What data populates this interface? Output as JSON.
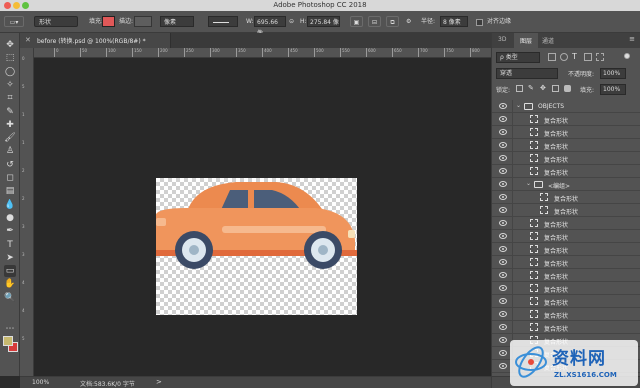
{
  "window": {
    "title": "Adobe Photoshop CC 2018"
  },
  "colors": {
    "accent_fill": "#e05858",
    "foreground": "#c7b96f",
    "background": "#d63b3b"
  },
  "options_bar": {
    "mode": "形状",
    "fill_label": "填充:",
    "stroke_label": "描边:",
    "stroke_width": "像素",
    "w_label": "W:",
    "w_value": "695.66 像",
    "link_icon": "link-icon",
    "h_label": "H:",
    "h_value": "275.84 像",
    "radius_label": "半径:",
    "radius_value": "8 像素",
    "align_edges": "对齐边缘"
  },
  "document": {
    "tab_title": "before (转换.psd @ 100%(RGB/8#) *"
  },
  "rulers": {
    "top": [
      "0",
      "50",
      "100",
      "150",
      "200",
      "250",
      "300",
      "350",
      "400",
      "450",
      "500",
      "550",
      "600",
      "650",
      "700",
      "750",
      "800"
    ],
    "left": [
      "0",
      "5",
      "1",
      "1",
      "2",
      "2",
      "3",
      "3",
      "4",
      "4",
      "5"
    ]
  },
  "status": {
    "zoom": "100%",
    "doc_info": "文档:583.6K/0 字节",
    "arrow": ">"
  },
  "panel_tabs": [
    "3D",
    "图层",
    "通道"
  ],
  "layers_panel": {
    "kind": "ρ 类型",
    "blend_mode": "穿透",
    "opacity_label": "不透明度:",
    "opacity_value": "100%",
    "lock_label": "锁定:",
    "fill_label": "填充:",
    "fill_value": "100%",
    "layers": [
      {
        "name": "OBJECTS",
        "type": "group",
        "indent": 0
      },
      {
        "name": "复合形状",
        "type": "shape",
        "indent": 1
      },
      {
        "name": "复合形状",
        "type": "shape",
        "indent": 1
      },
      {
        "name": "复合形状",
        "type": "shape",
        "indent": 1
      },
      {
        "name": "复合形状",
        "type": "shape",
        "indent": 1
      },
      {
        "name": "复合形状",
        "type": "shape",
        "indent": 1
      },
      {
        "name": "<编组>",
        "type": "group",
        "indent": 1
      },
      {
        "name": "复合形状",
        "type": "shape",
        "indent": 2
      },
      {
        "name": "复合形状",
        "type": "shape",
        "indent": 2
      },
      {
        "name": "复合形状",
        "type": "shape",
        "indent": 1
      },
      {
        "name": "复合形状",
        "type": "shape",
        "indent": 1
      },
      {
        "name": "复合形状",
        "type": "shape",
        "indent": 1
      },
      {
        "name": "复合形状",
        "type": "shape",
        "indent": 1
      },
      {
        "name": "复合形状",
        "type": "shape",
        "indent": 1
      },
      {
        "name": "复合形状",
        "type": "shape",
        "indent": 1
      },
      {
        "name": "复合形状",
        "type": "shape",
        "indent": 1
      },
      {
        "name": "复合形状",
        "type": "shape",
        "indent": 1
      },
      {
        "name": "复合形状",
        "type": "shape",
        "indent": 1
      },
      {
        "name": "复合形状",
        "type": "shape",
        "indent": 1
      },
      {
        "name": "复合形状",
        "type": "shape",
        "indent": 1
      },
      {
        "name": "复合形状",
        "type": "shape",
        "indent": 1
      }
    ]
  },
  "tools": [
    "move-tool-icon",
    "marquee-tool-icon",
    "lasso-tool-icon",
    "magic-wand-tool-icon",
    "crop-tool-icon",
    "eyedropper-tool-icon",
    "healing-brush-tool-icon",
    "brush-tool-icon",
    "clone-stamp-tool-icon",
    "history-brush-tool-icon",
    "eraser-tool-icon",
    "gradient-tool-icon",
    "blur-tool-icon",
    "dodge-tool-icon",
    "pen-tool-icon",
    "type-tool-icon",
    "path-selection-tool-icon",
    "rectangle-tool-icon",
    "hand-tool-icon",
    "zoom-tool-icon",
    "edit-toolbar-icon"
  ],
  "tool_glyphs": [
    "✥",
    "⬚",
    "◯",
    "✧",
    "⌗",
    "✎",
    "✚",
    "🖌",
    "♙",
    "↺",
    "◻",
    "▤",
    "💧",
    "●",
    "✒",
    "T",
    "➤",
    "▭",
    "✋",
    "🔍",
    "⋯"
  ],
  "watermark": {
    "title": "资料网",
    "url": "ZL.XS1616.COM"
  }
}
